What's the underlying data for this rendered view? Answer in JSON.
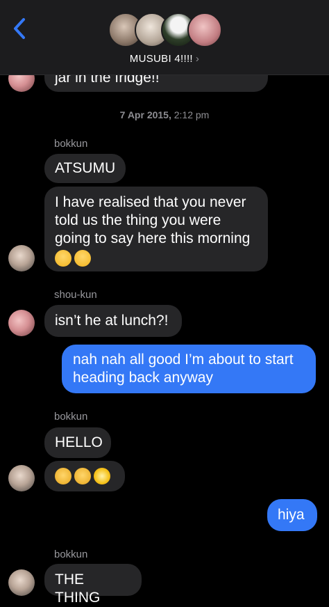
{
  "header": {
    "title": "MUSUBI 4!!!!",
    "chevron": "›",
    "back_icon": "chevron-left-icon",
    "avatar_colors": [
      "#9c8a7c",
      "#c9bcb0",
      "#4e6b48",
      "#c98a8a"
    ]
  },
  "messages": {
    "partial_text": "jar in the fridge!!",
    "timestamp_date": "7 Apr 2015,",
    "timestamp_time": " 2:12 pm",
    "sender1": "bokkun",
    "m1": "ATSUMU",
    "m2": "I have realised that you never told us the thing you were going to say here this morning",
    "m2_emoji": "😟😟",
    "sender2": "shou-kun",
    "m3": "isn’t he at lunch?!",
    "m4": "nah nah all good I’m about to start heading back anyway",
    "sender3": "bokkun",
    "m5": "HELLO",
    "m6_emoji": "👋🤩🌟",
    "m7": "hiya",
    "sender4": "bokkun",
    "m8": "THE THING"
  },
  "colors": {
    "incoming_bubble": "#262628",
    "outgoing_bubble": "#3478f6",
    "accent": "#3478f6"
  }
}
